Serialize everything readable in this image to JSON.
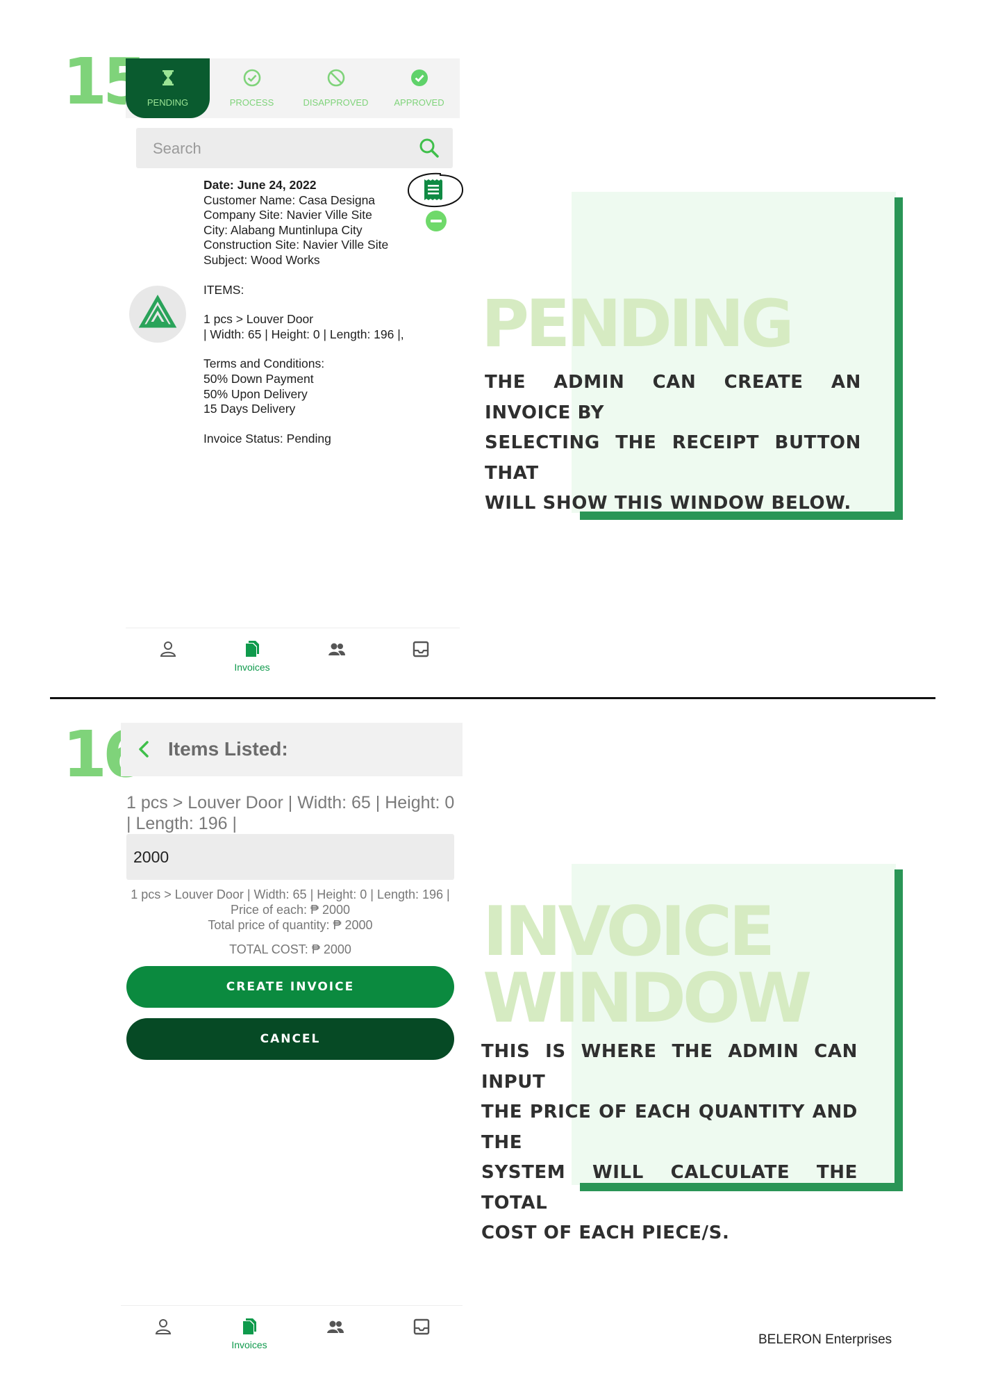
{
  "colors": {
    "accent": "#0b8a3f",
    "dark_green": "#064a25",
    "light_green": "#7fd37a",
    "panel_bg": "#eefaf0",
    "panel_bar": "#2a9556",
    "title_tint": "#d6ebc2"
  },
  "step15": {
    "number": "15",
    "tabs": [
      {
        "label": "PENDING",
        "icon": "hourglass-icon",
        "active": true
      },
      {
        "label": "PROCESS",
        "icon": "check-circle-outline-icon"
      },
      {
        "label": "DISAPPROVED",
        "icon": "prohibited-icon"
      },
      {
        "label": "APPROVED",
        "icon": "check-circle-filled-icon"
      }
    ],
    "search_placeholder": "Search",
    "invoice": {
      "date": "Date: June 24, 2022",
      "customer": "Customer Name: Casa Designa",
      "company_site": "Company Site: Navier Ville Site",
      "city": "City: Alabang Muntinlupa City",
      "construction_site": "Construction Site: Navier Ville Site",
      "subject": "Subject: Wood Works",
      "items_heading": "ITEMS:",
      "item_line1": "1 pcs > Louver Door",
      "item_line2": " | Width: 65 | Height: 0 | Length: 196 |,",
      "terms_heading": "Terms and Conditions:",
      "term1": "50% Down Payment",
      "term2": "50% Upon Delivery",
      "term3": "15 Days Delivery",
      "status": "Invoice Status: Pending"
    },
    "nav": [
      {
        "icon": "person-icon",
        "label": ""
      },
      {
        "icon": "invoices-icon",
        "label": "Invoices"
      },
      {
        "icon": "group-icon",
        "label": ""
      },
      {
        "icon": "inbox-icon",
        "label": ""
      }
    ],
    "panel_title": "PENDING",
    "panel_desc": [
      "THE ADMIN CAN CREATE AN INVOICE BY",
      "SELECTING THE RECEIPT BUTTON  THAT",
      "WILL SHOW THIS WINDOW BELOW."
    ]
  },
  "step16": {
    "number": "16",
    "header_title": "Items Listed:",
    "item_line1": "1 pcs > Louver Door | Width: 65 | Height: 0",
    "item_line2": "| Length: 196 |",
    "price_value": "2000",
    "summary_item": "1 pcs > Louver Door | Width: 65 | Height: 0 | Length: 196 |",
    "summary_price": "Price of each: ₱ 2000",
    "summary_total_qty": "Total price of quantity: ₱ 2000",
    "summary_total_cost": "TOTAL COST: ₱ 2000",
    "create_button": "CREATE INVOICE",
    "cancel_button": "CANCEL",
    "nav": [
      {
        "icon": "person-icon",
        "label": ""
      },
      {
        "icon": "invoices-icon",
        "label": "Invoices"
      },
      {
        "icon": "group-icon",
        "label": ""
      },
      {
        "icon": "inbox-icon",
        "label": ""
      }
    ],
    "panel_title_line1": "INVOICE",
    "panel_title_line2": "WINDOW",
    "panel_desc": [
      "THIS IS WHERE THE ADMIN CAN INPUT",
      "THE PRICE OF EACH QUANTITY AND THE",
      "SYSTEM WILL CALCULATE THE TOTAL",
      "COST OF EACH PIECE/S."
    ]
  },
  "footer": "BELERON Enterprises"
}
